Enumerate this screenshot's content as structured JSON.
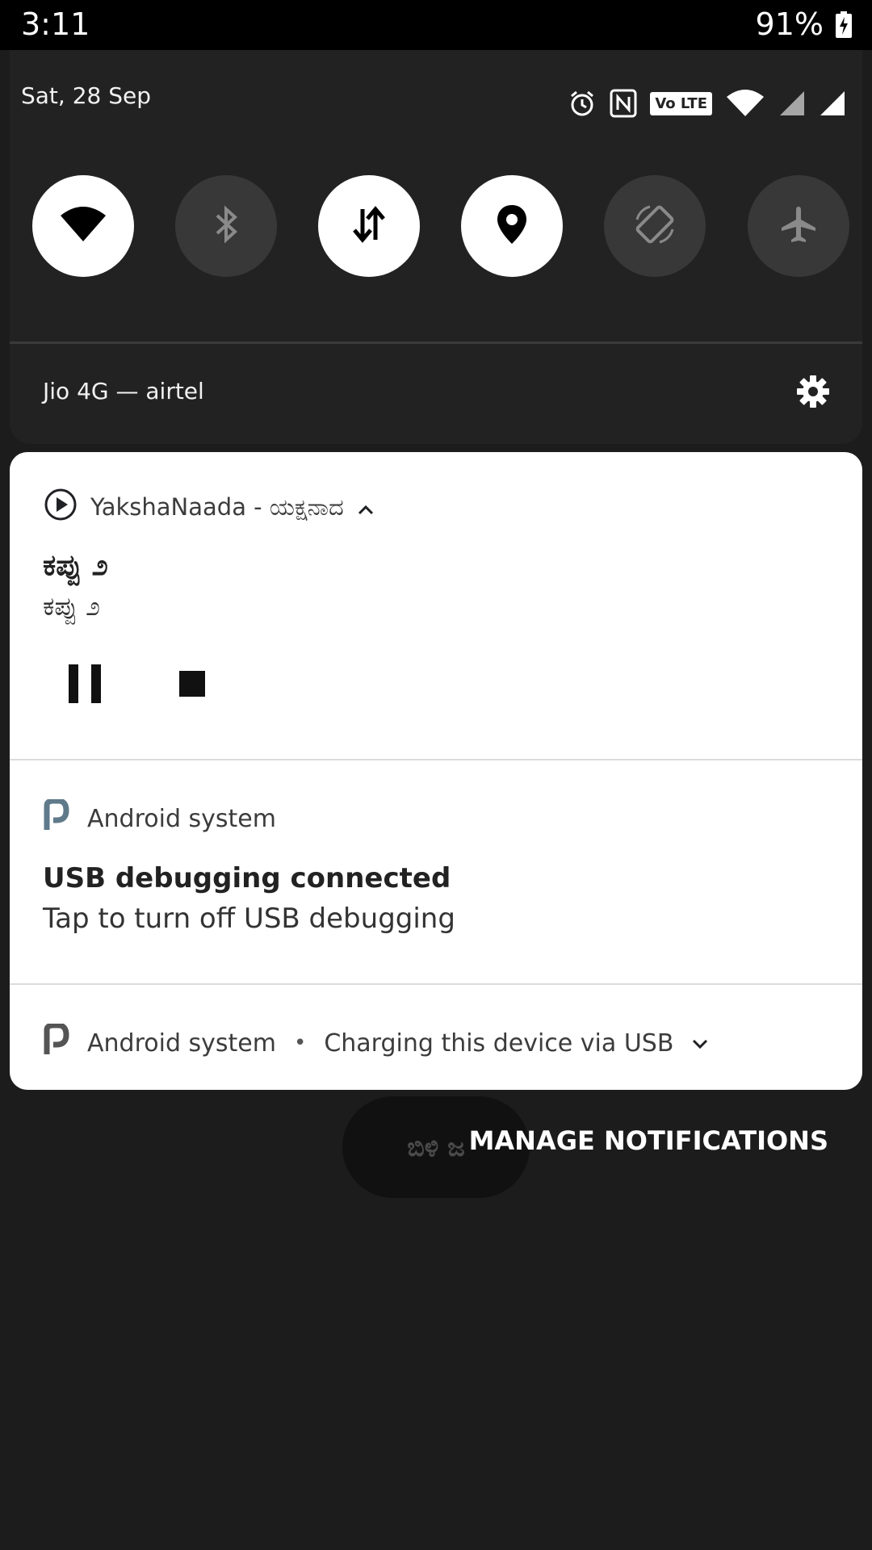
{
  "status_bar": {
    "time": "3:11",
    "battery_text": "91%",
    "battery_icon": "battery-charging-icon"
  },
  "quick_settings": {
    "date": "Sat, 28 Sep",
    "status_icons": [
      "alarm-icon",
      "nfc-icon",
      "volte-icon",
      "wifi-signal-icon",
      "cell-signal-icon",
      "cell-signal-icon"
    ],
    "volte_label": "Vo LTE",
    "tiles": [
      {
        "name": "wifi",
        "state": "on"
      },
      {
        "name": "bluetooth",
        "state": "off"
      },
      {
        "name": "mobile-data",
        "state": "on"
      },
      {
        "name": "location",
        "state": "on"
      },
      {
        "name": "auto-rotate",
        "state": "off"
      },
      {
        "name": "airplane-mode",
        "state": "off"
      }
    ],
    "network_label": "Jio 4G — airtel"
  },
  "notifications": {
    "media": {
      "app_name": "YakshaNaada - ಯಕ್ಷನಾದ",
      "title": "ಕಪ್ಪು ೨",
      "subtitle": "ಕಪ್ಪು ೨"
    },
    "usb_debugging": {
      "app_name": "Android system",
      "title": "USB debugging connected",
      "text": "Tap to turn off USB debugging"
    },
    "charging": {
      "app_name": "Android system",
      "separator": "•",
      "text": "Charging this device via USB"
    }
  },
  "footer": {
    "clear_all_label": "ಬಿಳಿ ಜ",
    "manage_label": "MANAGE NOTIFICATIONS"
  },
  "colors": {
    "background": "#1c1c1c",
    "panel": "#222222",
    "tile_on": "#ffffff",
    "tile_off": "#383838",
    "card": "#ffffff"
  }
}
